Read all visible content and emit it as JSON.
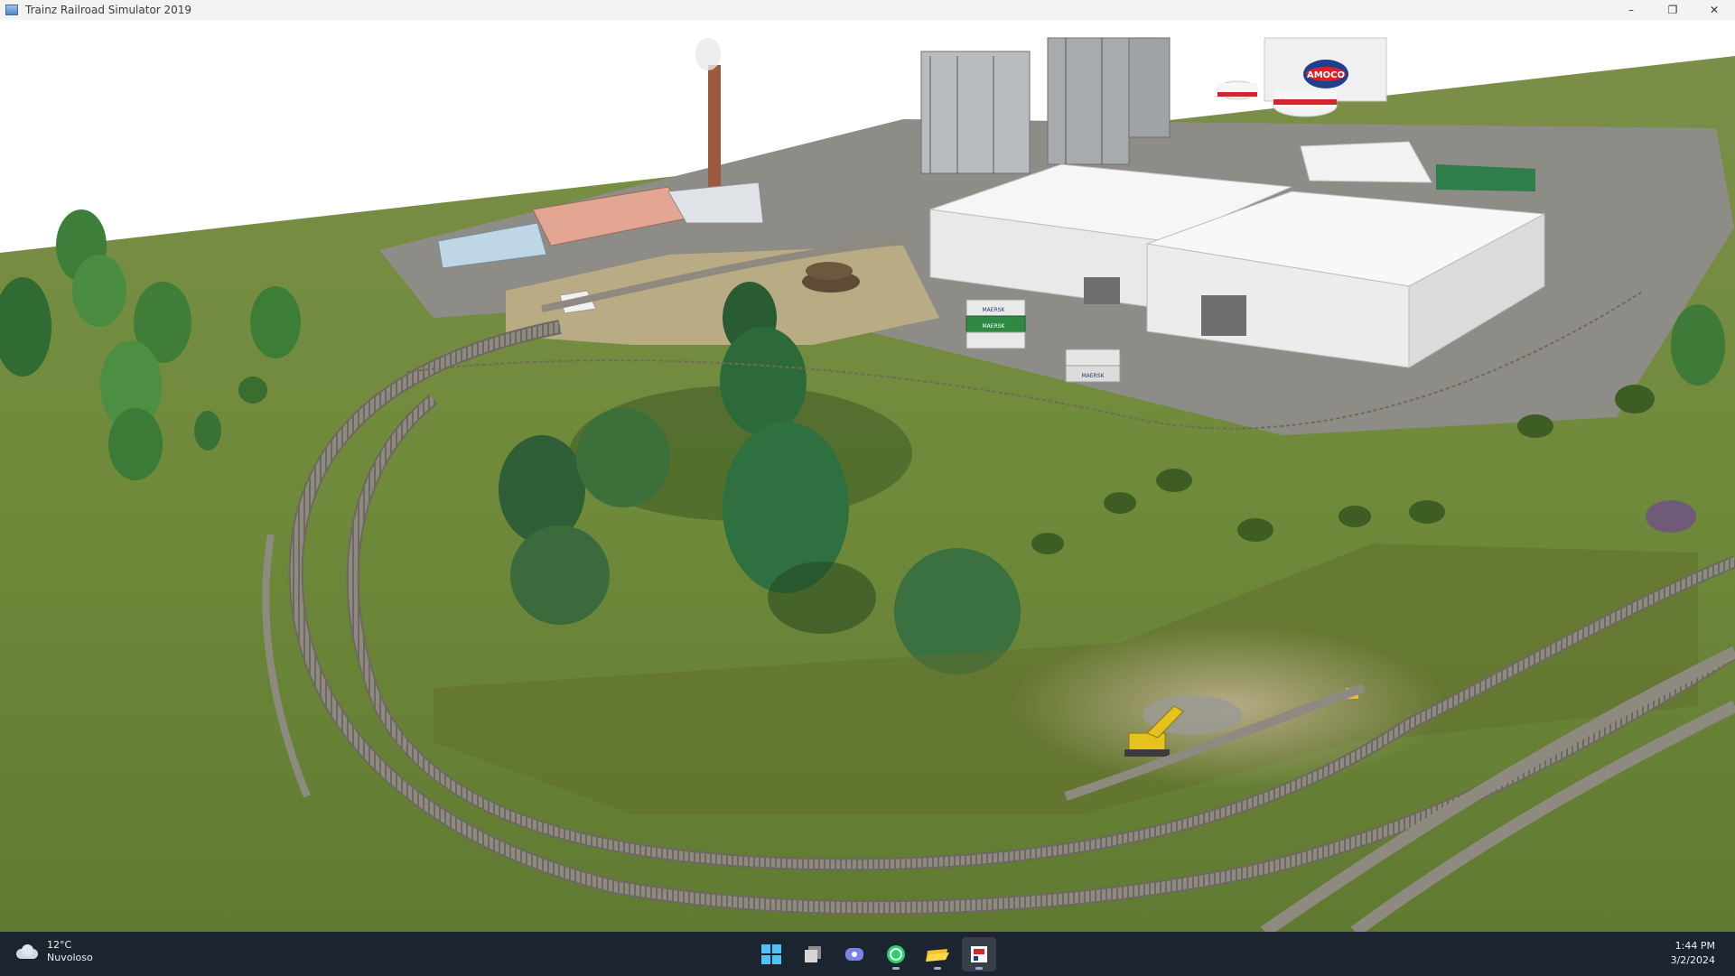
{
  "window": {
    "title": "Trainz Railroad Simulator 2019",
    "controls": {
      "minimize": "–",
      "restore": "❐",
      "close": "✕"
    }
  },
  "scene": {
    "tank_logo": "AMOCO",
    "container_labels": [
      "MAERSK",
      "MAERSK",
      "MAERSK"
    ],
    "colors": {
      "grass": "#6f8a3a",
      "grass_dark": "#586f2c",
      "dirt": "#8a7a55",
      "pavement": "#8d8c86",
      "rail": "#8f8a80",
      "warehouse": "#f4f4f4",
      "tree": "#2f6b34"
    }
  },
  "taskbar": {
    "weather": {
      "temp": "12°C",
      "condition": "Nuvoloso",
      "icon": "cloud-icon"
    },
    "apps": [
      {
        "name": "start",
        "icon": "windows-logo-icon"
      },
      {
        "name": "task-view",
        "icon": "task-view-icon"
      },
      {
        "name": "teams",
        "icon": "teams-icon"
      },
      {
        "name": "whatsapp",
        "icon": "whatsapp-icon"
      },
      {
        "name": "file-explorer",
        "icon": "folder-icon"
      },
      {
        "name": "trainz",
        "icon": "trainz-icon"
      }
    ],
    "clock": {
      "time": "1:44 PM",
      "date": "3/2/2024"
    }
  }
}
